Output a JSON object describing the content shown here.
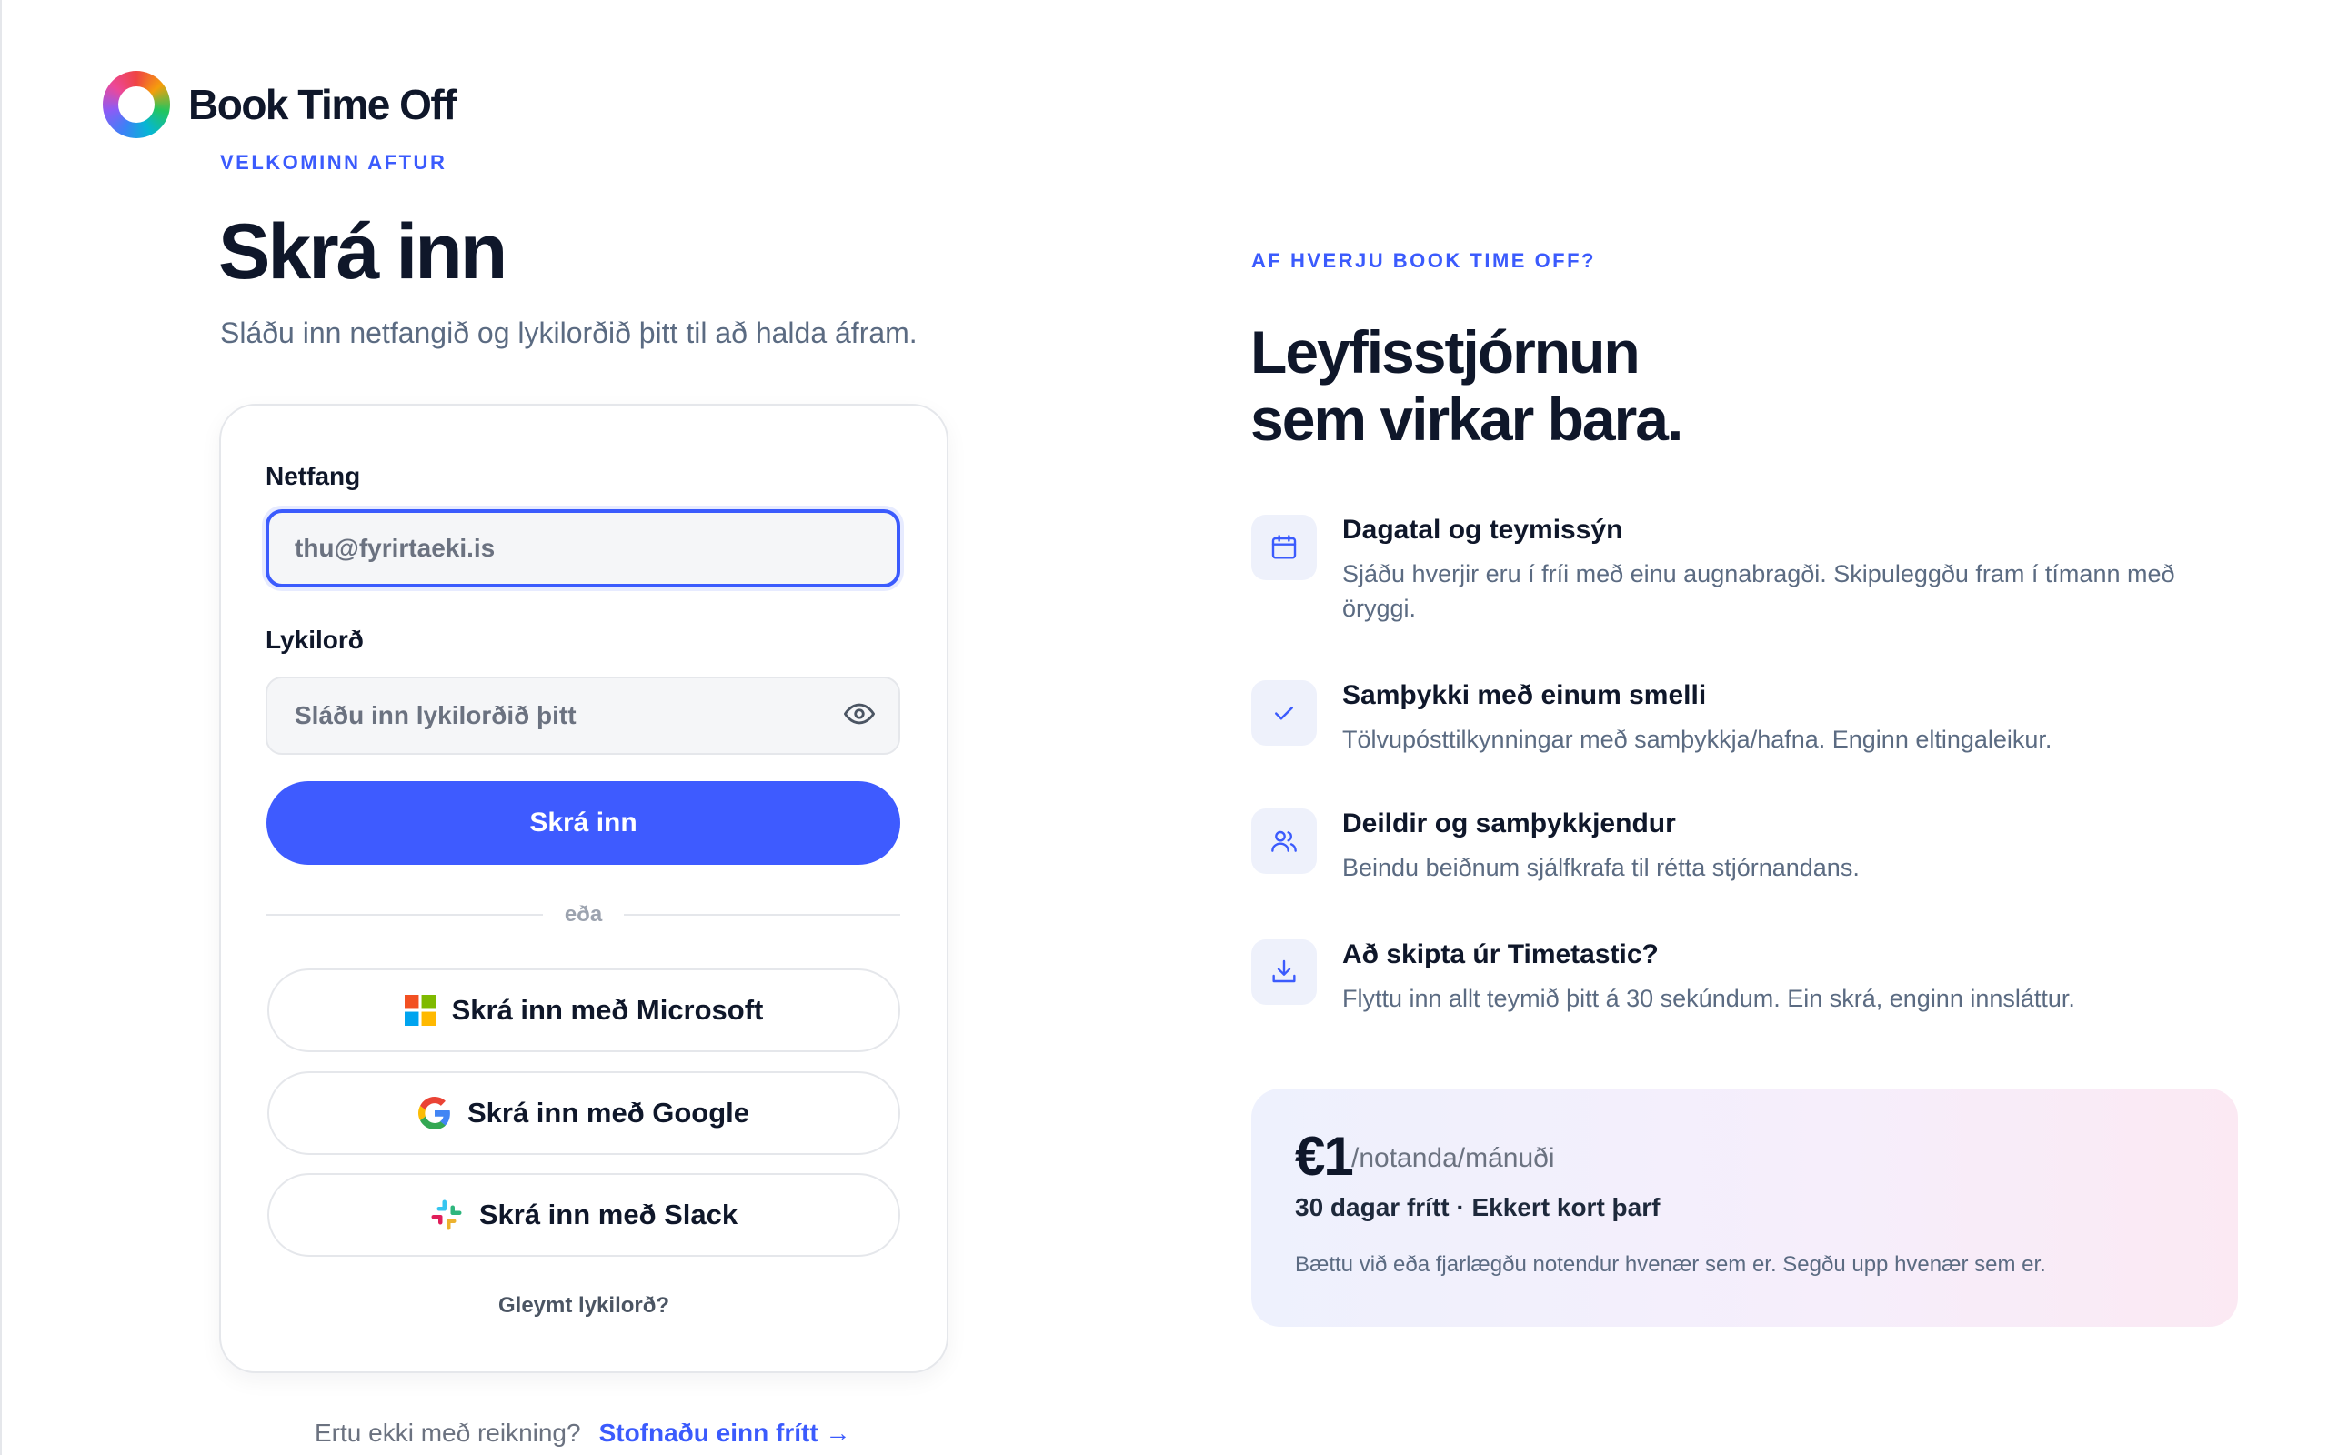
{
  "brand": {
    "name": "Book Time Off"
  },
  "login": {
    "eyebrow": "VELKOMINN AFTUR",
    "title": "Skrá inn",
    "subtitle": "Sláðu inn netfangið og lykilorðið þitt til að halda áfram.",
    "email_label": "Netfang",
    "email_placeholder": "thu@fyrirtaeki.is",
    "password_label": "Lykilorð",
    "password_placeholder": "Sláðu inn lykilorðið þitt",
    "submit_label": "Skrá inn",
    "divider": "eða",
    "microsoft_label": "Skrá inn með Microsoft",
    "google_label": "Skrá inn með Google",
    "slack_label": "Skrá inn með Slack",
    "forgot_label": "Gleymt lykilorð?",
    "no_account_text": "Ertu ekki með reikning?",
    "signup_link": "Stofnaðu einn frítt →"
  },
  "marketing": {
    "eyebrow": "AF HVERJU BOOK TIME OFF?",
    "headline_line1": "Leyfisstjórnun",
    "headline_line2": "sem virkar bara.",
    "features": [
      {
        "icon": "calendar-icon",
        "title": "Dagatal og teymissýn",
        "desc": "Sjáðu hverjir eru í fríi með einu augnabragði. Skipuleggðu fram í tímann með öryggi."
      },
      {
        "icon": "check-icon",
        "title": "Samþykki með einum smelli",
        "desc": "Tölvupósttilkynningar með samþykkja/hafna. Enginn eltingaleikur."
      },
      {
        "icon": "users-icon",
        "title": "Deildir og samþykkjendur",
        "desc": "Beindu beiðnum sjálfkrafa til rétta stjórnandans."
      },
      {
        "icon": "download-icon",
        "title": "Að skipta úr Timetastic?",
        "desc": "Flyttu inn allt teymið þitt á 30 sekúndum. Ein skrá, enginn innsláttur."
      }
    ],
    "pricing": {
      "amount": "€1",
      "unit": "/notanda/mánuði",
      "subtitle": "30 dagar frítt · Ekkert kort þarf",
      "note": "Bættu við eða fjarlægðu notendur hvenær sem er. Segðu upp hvenær sem er."
    }
  },
  "colors": {
    "accent": "#3e5bff",
    "heading": "#0f172a",
    "muted": "#5b6b82"
  }
}
